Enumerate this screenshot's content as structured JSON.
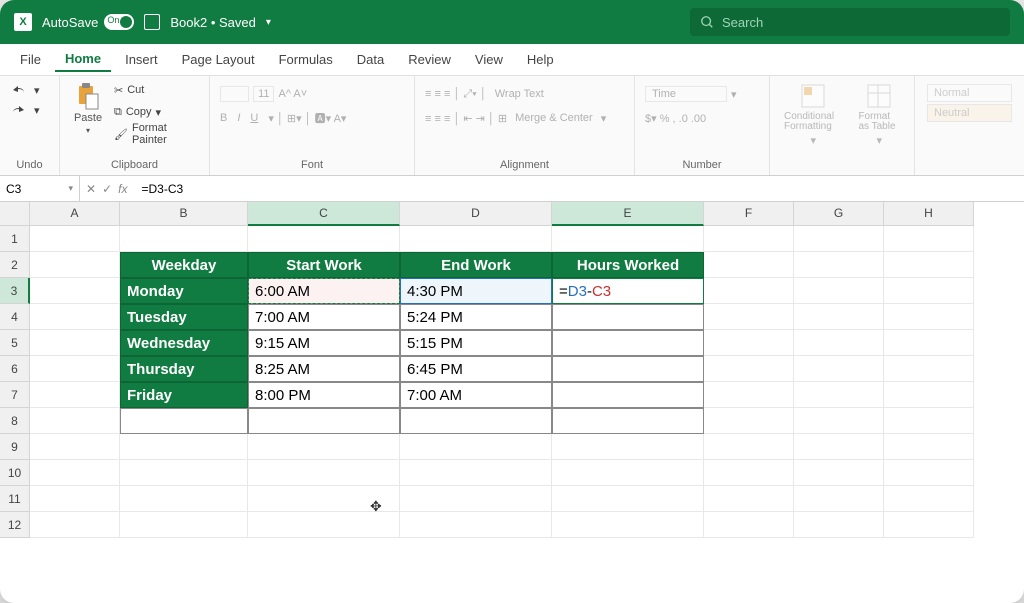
{
  "titlebar": {
    "autosave": "AutoSave",
    "autosave_state": "On",
    "filename": "Book2 • Saved",
    "search_placeholder": "Search"
  },
  "menu": [
    "File",
    "Home",
    "Insert",
    "Page Layout",
    "Formulas",
    "Data",
    "Review",
    "View",
    "Help"
  ],
  "menu_active": 1,
  "ribbon": {
    "undo": "Undo",
    "paste": "Paste",
    "cut": "Cut",
    "copy": "Copy",
    "format_painter": "Format Painter",
    "clipboard": "Clipboard",
    "font": "Font",
    "font_size": "11",
    "alignment": "Alignment",
    "wrap": "Wrap Text",
    "merge": "Merge & Center",
    "number": "Number",
    "number_format": "Time",
    "cond_fmt": "Conditional Formatting",
    "fmt_table": "Format as Table",
    "normal": "Normal",
    "neutral": "Neutral"
  },
  "formula_bar": {
    "name_box": "C3",
    "formula": "=D3-C3"
  },
  "columns": [
    "A",
    "B",
    "C",
    "D",
    "E",
    "F",
    "G",
    "H"
  ],
  "rows": [
    "1",
    "2",
    "3",
    "4",
    "5",
    "6",
    "7",
    "8",
    "9",
    "10",
    "11",
    "12"
  ],
  "table": {
    "headers": [
      "Weekday",
      "Start Work",
      "End Work",
      "Hours Worked"
    ],
    "rows": [
      {
        "weekday": "Monday",
        "start": "6:00 AM",
        "end": "4:30 PM",
        "hours_formula": {
          "eq": "=",
          "d": "D3",
          "dash": "-",
          "c": "C3"
        }
      },
      {
        "weekday": "Tuesday",
        "start": "7:00 AM",
        "end": "5:24 PM"
      },
      {
        "weekday": "Wednesday",
        "start": "9:15 AM",
        "end": "5:15 PM"
      },
      {
        "weekday": "Thursday",
        "start": "8:25 AM",
        "end": "6:45 PM"
      },
      {
        "weekday": "Friday",
        "start": "8:00 PM",
        "end": "7:00 AM"
      }
    ]
  }
}
